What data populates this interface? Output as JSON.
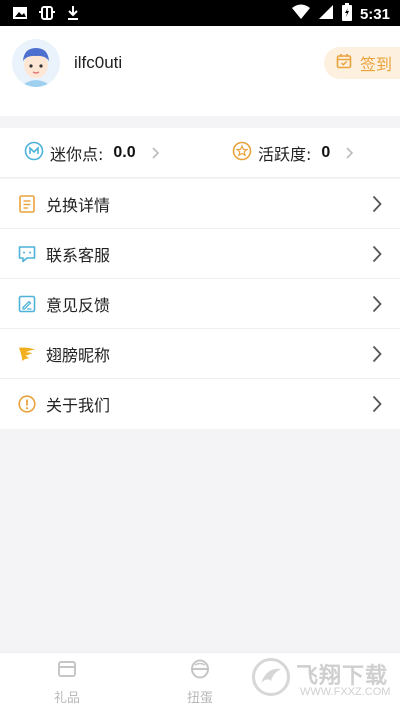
{
  "status_bar": {
    "time": "5:31",
    "left_icons": [
      "image-icon",
      "bug-icon",
      "download-icon"
    ],
    "right_icons": [
      "wifi-icon",
      "signal-icon",
      "battery-icon"
    ]
  },
  "profile": {
    "username": "ilfc0uti",
    "checkin_label": "签到",
    "accent_color": "#e9a33c"
  },
  "stats": [
    {
      "label": "迷你点:",
      "value": "0.0",
      "icon": "mini-points-icon"
    },
    {
      "label": "活跃度:",
      "value": "0",
      "icon": "star-badge-icon"
    }
  ],
  "menu": [
    {
      "label": "兑换详情",
      "icon": "document-icon"
    },
    {
      "label": "联系客服",
      "icon": "chat-icon"
    },
    {
      "label": "意见反馈",
      "icon": "feedback-icon"
    },
    {
      "label": "翅膀昵称",
      "icon": "wing-icon"
    },
    {
      "label": "关于我们",
      "icon": "info-icon"
    }
  ],
  "tabbar": [
    {
      "label": "礼品",
      "icon": "gift-box-icon"
    },
    {
      "label": "扭蛋",
      "icon": "capsule-icon"
    }
  ],
  "watermark": {
    "title": "飞翔下载",
    "url": "WWW.FXXZ.COM"
  }
}
